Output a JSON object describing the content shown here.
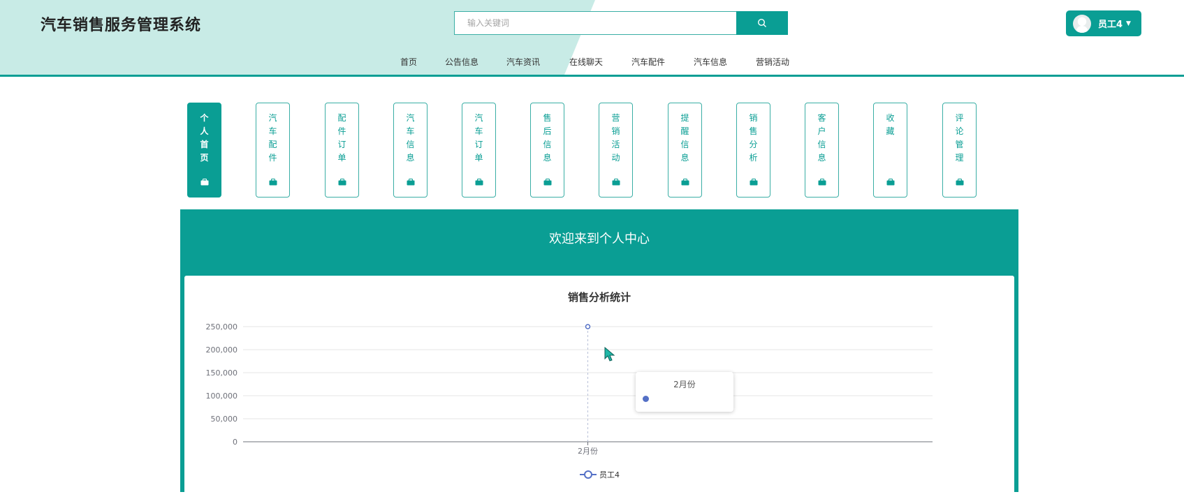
{
  "header": {
    "title": "汽车销售服务管理系统",
    "search_placeholder": "输入关键词",
    "user_name": "员工4",
    "colors": {
      "accent": "#0a9e94",
      "banner_light": "#c8ebe6"
    }
  },
  "nav": {
    "items": [
      "首页",
      "公告信息",
      "汽车资讯",
      "在线聊天",
      "汽车配件",
      "汽车信息",
      "营销活动"
    ]
  },
  "side_menu": {
    "items": [
      {
        "label": "个人首页",
        "active": true
      },
      {
        "label": "汽车配件",
        "active": false
      },
      {
        "label": "配件订单",
        "active": false
      },
      {
        "label": "汽车信息",
        "active": false
      },
      {
        "label": "汽车订单",
        "active": false
      },
      {
        "label": "售后信息",
        "active": false
      },
      {
        "label": "营销活动",
        "active": false
      },
      {
        "label": "提醒信息",
        "active": false
      },
      {
        "label": "销售分析",
        "active": false
      },
      {
        "label": "客户信息",
        "active": false
      },
      {
        "label": "收藏",
        "active": false
      },
      {
        "label": "评论管理",
        "active": false
      }
    ]
  },
  "banner": {
    "title": "欢迎来到个人中心"
  },
  "chart_data": {
    "type": "line",
    "title": "销售分析统计",
    "categories": [
      "2月份"
    ],
    "series": [
      {
        "name": "员工4",
        "values": [
          250000
        ],
        "color": "#5470c6"
      }
    ],
    "ylim": [
      0,
      250000
    ],
    "yticks": [
      "0",
      "50,000",
      "100,000",
      "150,000",
      "200,000",
      "250,000"
    ],
    "grid": true,
    "legend": "bottom-center",
    "tooltip": {
      "title": "2月份"
    }
  }
}
